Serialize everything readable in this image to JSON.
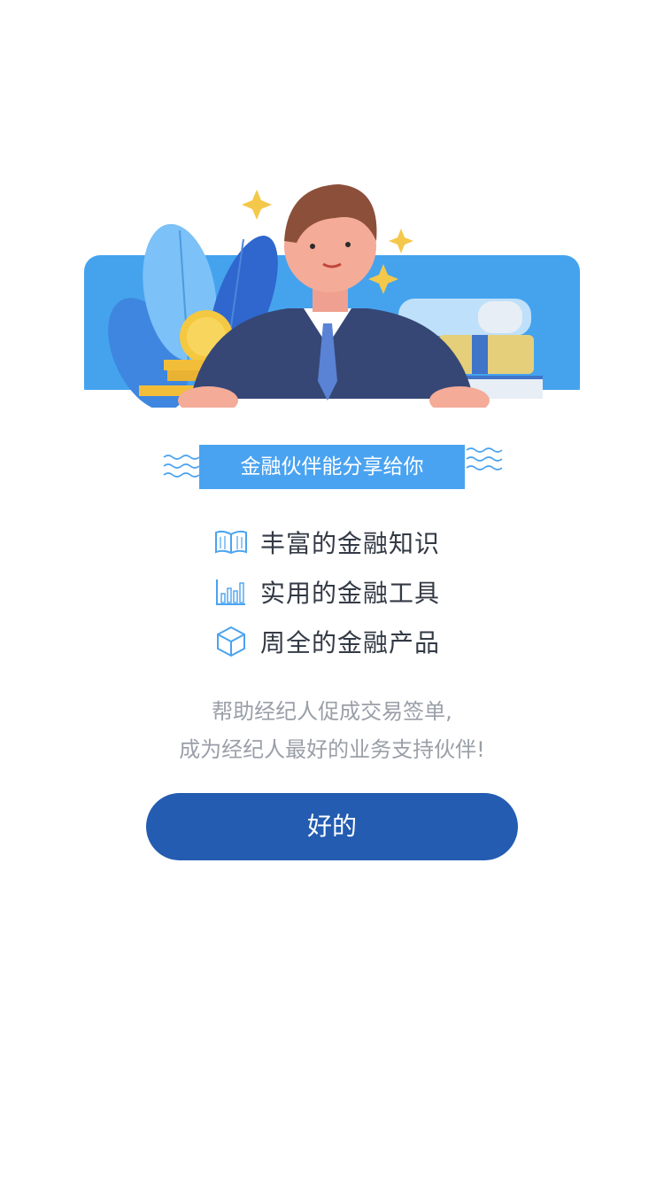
{
  "ribbon": {
    "title": "金融伙伴能分享给你"
  },
  "features": [
    {
      "icon": "open-book-icon",
      "label": "丰富的金融知识"
    },
    {
      "icon": "bar-chart-icon",
      "label": "实用的金融工具"
    },
    {
      "icon": "cube-icon",
      "label": "周全的金融产品"
    }
  ],
  "description": {
    "line1": "帮助经纪人促成交易签单,",
    "line2": "成为经纪人最好的业务支持伙伴!"
  },
  "ok_button": {
    "label": "好的"
  },
  "colors": {
    "accent": "#4aa3f0",
    "button": "#235cb1",
    "text": "#333a45",
    "muted": "#9a9fa8"
  }
}
